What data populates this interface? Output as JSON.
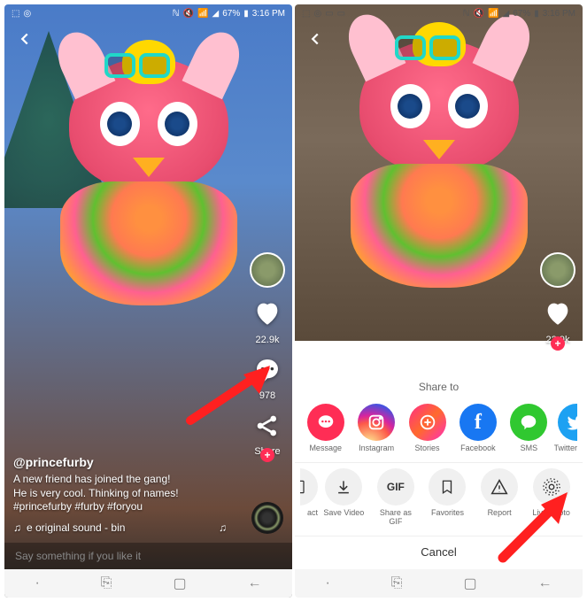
{
  "status": {
    "time": "3:16 PM",
    "battery": "67%",
    "icons_left": [
      "⬚",
      "◎"
    ],
    "icons_left2": [
      "⬚",
      "◎",
      "▭",
      "▭"
    ],
    "icons_right": [
      "ℕ",
      "🔇",
      "📶",
      "◢"
    ]
  },
  "left_video": {
    "username": "@princefurby",
    "caption": "A new friend has joined the gang!\nHe is very cool. Thinking of names!\n#princefurby #furby #foryou",
    "music_icon": "♫",
    "music_label": "e   original sound - bin",
    "comment_placeholder": "Say something if you like it",
    "rail": {
      "likes": "22.9k",
      "comments": "978",
      "share": "Share"
    }
  },
  "right_video": {
    "rail": {
      "likes": "22.9k"
    }
  },
  "share_sheet": {
    "title": "Share to",
    "row1": [
      {
        "key": "message",
        "label": "Message",
        "color": "msg",
        "glyph": "chat"
      },
      {
        "key": "instagram",
        "label": "Instagram",
        "color": "ig",
        "glyph": "ig"
      },
      {
        "key": "stories",
        "label": "Stories",
        "color": "stories",
        "glyph": "stories"
      },
      {
        "key": "facebook",
        "label": "Facebook",
        "color": "fb",
        "glyph": "fb"
      },
      {
        "key": "sms",
        "label": "SMS",
        "color": "sms",
        "glyph": "sms"
      },
      {
        "key": "twitter",
        "label": "Twitter",
        "color": "tw",
        "glyph": "tw"
      }
    ],
    "row2": [
      {
        "key": "act",
        "label": "act",
        "glyph": "▭"
      },
      {
        "key": "save-video",
        "label": "Save Video",
        "glyph": "⤓"
      },
      {
        "key": "gif",
        "label": "Share as\nGIF",
        "glyph": "GIF"
      },
      {
        "key": "favorites",
        "label": "Favorites",
        "glyph": "🔖"
      },
      {
        "key": "report",
        "label": "Report",
        "glyph": "⚠"
      },
      {
        "key": "live-photo",
        "label": "Live Photo",
        "glyph": "◎"
      }
    ],
    "cancel": "Cancel"
  },
  "nav": {
    "items": [
      "·",
      "⎘",
      "▢",
      "←"
    ]
  }
}
